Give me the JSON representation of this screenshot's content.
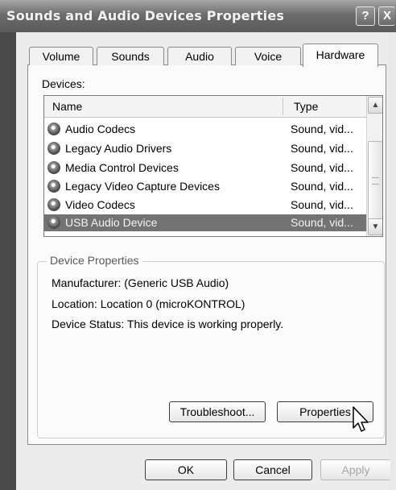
{
  "window": {
    "title": "Sounds and Audio Devices Properties",
    "help_button": "?",
    "close_button": "X"
  },
  "tabs": [
    {
      "label": "Volume",
      "active": false
    },
    {
      "label": "Sounds",
      "active": false
    },
    {
      "label": "Audio",
      "active": false
    },
    {
      "label": "Voice",
      "active": false
    },
    {
      "label": "Hardware",
      "active": true
    }
  ],
  "devices": {
    "label": "Devices:",
    "columns": {
      "name": "Name",
      "type": "Type"
    },
    "rows": [
      {
        "name": "Audio Codecs",
        "type": "Sound, vid...",
        "selected": false
      },
      {
        "name": "Legacy Audio Drivers",
        "type": "Sound, vid...",
        "selected": false
      },
      {
        "name": "Media Control Devices",
        "type": "Sound, vid...",
        "selected": false
      },
      {
        "name": "Legacy Video Capture Devices",
        "type": "Sound, vid...",
        "selected": false
      },
      {
        "name": "Video Codecs",
        "type": "Sound, vid...",
        "selected": false
      },
      {
        "name": "USB Audio Device",
        "type": "Sound, vid...",
        "selected": true
      }
    ],
    "icon": "speaker-icon"
  },
  "device_properties": {
    "group_title": "Device Properties",
    "manufacturer": "Manufacturer: (Generic USB Audio)",
    "location": "Location: Location 0 (microKONTROL)",
    "status": "Device Status: This device is working properly."
  },
  "buttons": {
    "troubleshoot": "Troubleshoot...",
    "properties": "Properties",
    "ok": "OK",
    "cancel": "Cancel",
    "apply": "Apply"
  },
  "colors": {
    "selection": "#737373",
    "titlebar": "#6c6c6c"
  }
}
